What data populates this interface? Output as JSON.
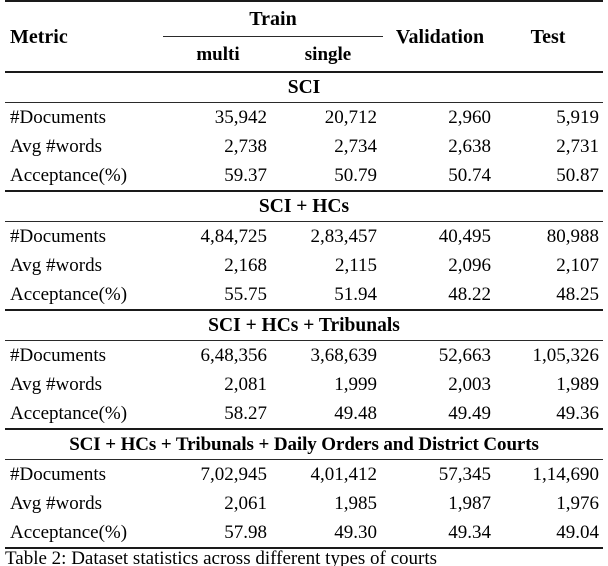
{
  "table": {
    "columns": {
      "metric_label": "Metric",
      "train_group_label": "Train",
      "train_sub": [
        "multi",
        "single"
      ],
      "validation_label": "Validation",
      "test_label": "Test"
    },
    "row_labels": [
      "#Documents",
      "Avg #words",
      "Acceptance(%)"
    ],
    "sections": [
      {
        "title": "SCI",
        "rows": [
          {
            "label": "#Documents",
            "multi": "35,942",
            "single": "20,712",
            "validation": "2,960",
            "test": "5,919"
          },
          {
            "label": "Avg #words",
            "multi": "2,738",
            "single": "2,734",
            "validation": "2,638",
            "test": "2,731"
          },
          {
            "label": "Acceptance(%)",
            "multi": "59.37",
            "single": "50.79",
            "validation": "50.74",
            "test": "50.87"
          }
        ]
      },
      {
        "title": "SCI + HCs",
        "rows": [
          {
            "label": "#Documents",
            "multi": "4,84,725",
            "single": "2,83,457",
            "validation": "40,495",
            "test": "80,988"
          },
          {
            "label": "Avg #words",
            "multi": "2,168",
            "single": "2,115",
            "validation": "2,096",
            "test": "2,107"
          },
          {
            "label": "Acceptance(%)",
            "multi": "55.75",
            "single": "51.94",
            "validation": "48.22",
            "test": "48.25"
          }
        ]
      },
      {
        "title": "SCI + HCs + Tribunals",
        "rows": [
          {
            "label": "#Documents",
            "multi": "6,48,356",
            "single": "3,68,639",
            "validation": "52,663",
            "test": "1,05,326"
          },
          {
            "label": "Avg #words",
            "multi": "2,081",
            "single": "1,999",
            "validation": "2,003",
            "test": "1,989"
          },
          {
            "label": "Acceptance(%)",
            "multi": "58.27",
            "single": "49.48",
            "validation": "49.49",
            "test": "49.36"
          }
        ]
      },
      {
        "title": "SCI + HCs + Tribunals + Daily Orders and District Courts",
        "rows": [
          {
            "label": "#Documents",
            "multi": "7,02,945",
            "single": "4,01,412",
            "validation": "57,345",
            "test": "1,14,690"
          },
          {
            "label": "Avg #words",
            "multi": "2,061",
            "single": "1,985",
            "validation": "1,987",
            "test": "1,976"
          },
          {
            "label": "Acceptance(%)",
            "multi": "57.98",
            "single": "49.30",
            "validation": "49.34",
            "test": "49.04"
          }
        ]
      }
    ]
  },
  "caption": {
    "text": "Table 2: Dataset statistics across different types of courts"
  },
  "colors": {
    "rule": "#1a1a1a",
    "text": "#000000",
    "background": "#ffffff"
  }
}
